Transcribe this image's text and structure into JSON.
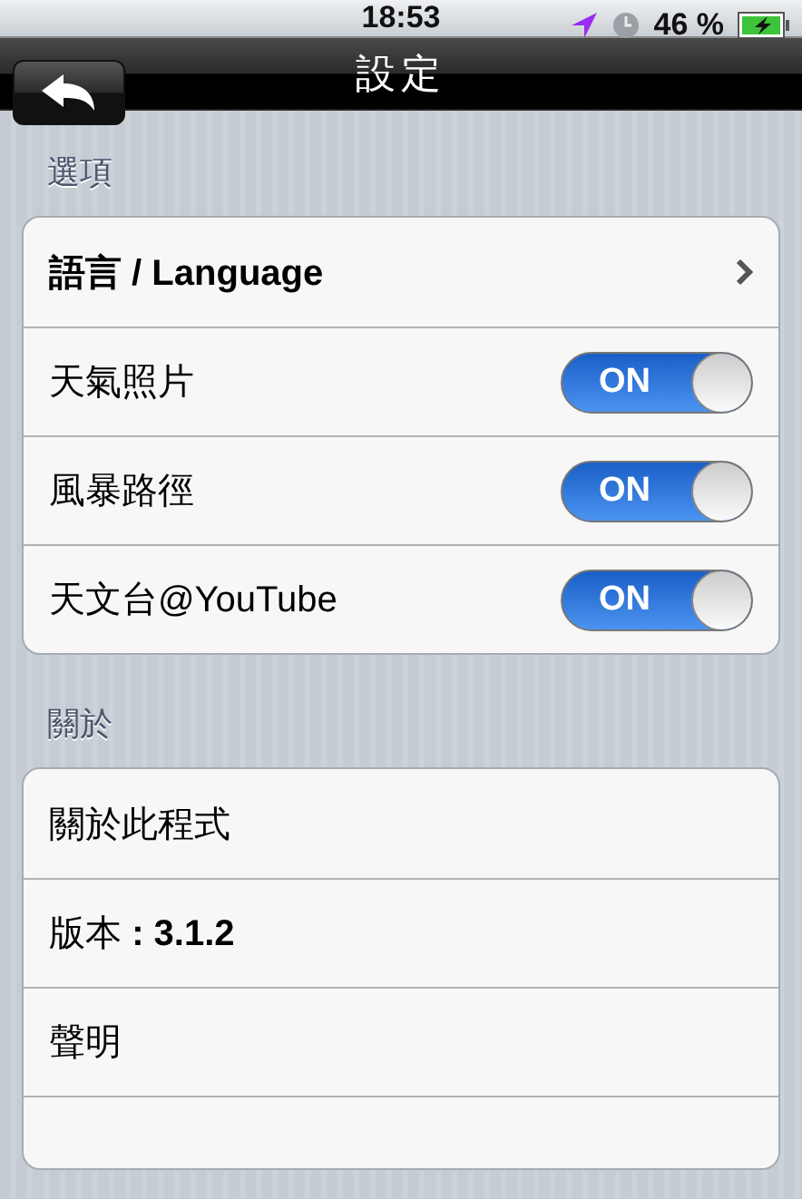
{
  "status_bar": {
    "time": "18:53",
    "battery": "46 %"
  },
  "nav_bar": {
    "title": "設定"
  },
  "sections": [
    {
      "title": "選項",
      "rows": [
        {
          "kind": "link",
          "label": "語言 / Language"
        },
        {
          "kind": "toggle",
          "label": "天氣照片",
          "on": true,
          "on_label": "ON"
        },
        {
          "kind": "toggle",
          "label": "風暴路徑",
          "on": true,
          "on_label": "ON"
        },
        {
          "kind": "toggle",
          "label": "天文台@YouTube",
          "on": true,
          "on_label": "ON"
        }
      ]
    },
    {
      "title": "關於",
      "rows": [
        {
          "kind": "plain",
          "label": "關於此程式"
        },
        {
          "kind": "plain",
          "label": "版本 **: 3.1.2**"
        },
        {
          "kind": "plain",
          "label": "聲明"
        }
      ]
    }
  ]
}
